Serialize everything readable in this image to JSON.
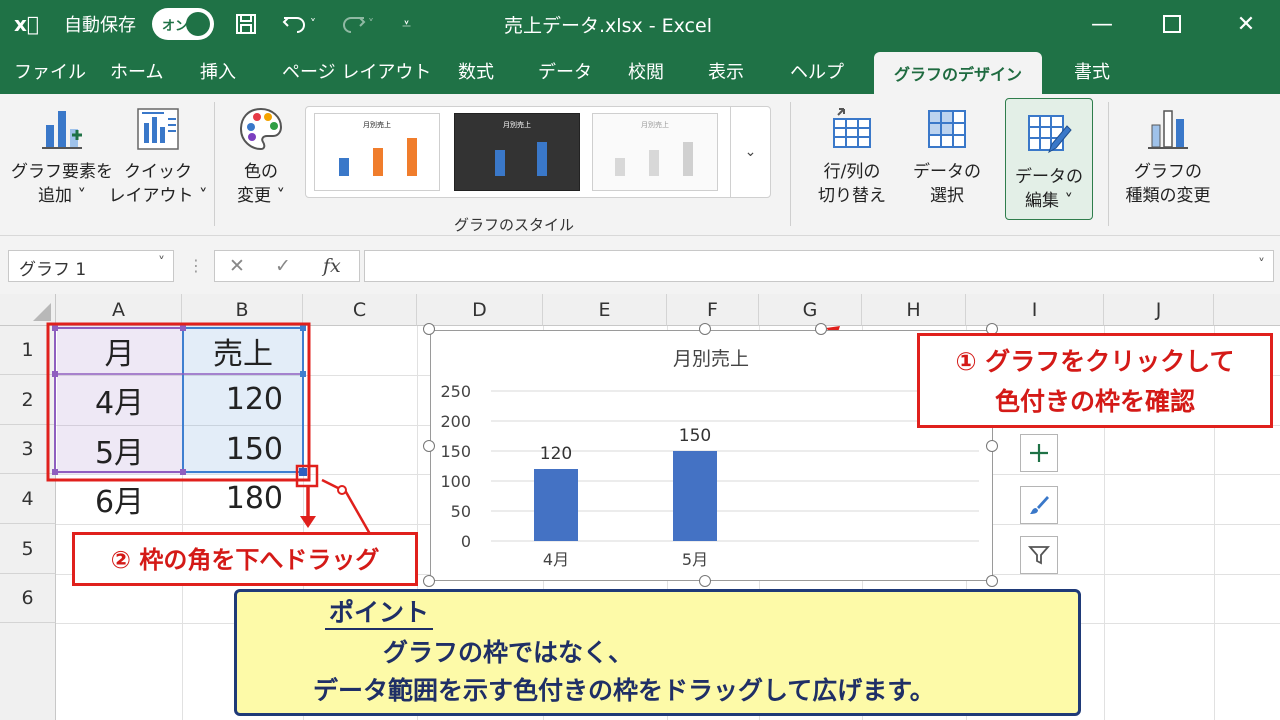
{
  "titlebar": {
    "app_icon": "excel-logo-icon",
    "autosave_label": "自動保存",
    "autosave_state": "オン",
    "document_title": "売上データ.xlsx  -  Excel"
  },
  "tabs": [
    "ファイル",
    "ホーム",
    "挿入",
    "ページ レイアウト",
    "数式",
    "データ",
    "校閲",
    "表示",
    "ヘルプ",
    "グラフのデザイン",
    "書式"
  ],
  "active_tab": "グラフのデザイン",
  "ribbon": {
    "add_element": "グラフ要素を",
    "add_element2": "追加 ˅",
    "quick_layout": "クイック",
    "quick_layout2": "レイアウト ˅",
    "change_color": "色の",
    "change_color2": "変更 ˅",
    "chart_styles_label": "グラフのスタイル",
    "style_thumb_title": "月別売上",
    "switch_row_col": "行/列の",
    "switch_row_col2": "切り替え",
    "select_data": "データの",
    "select_data2": "選択",
    "edit_data": "データの",
    "edit_data2": "編集 ˅",
    "change_type": "グラフの",
    "change_type2": "種類の変更"
  },
  "formula_bar": {
    "name_box": "グラフ 1",
    "cancel": "✕",
    "enter": "✓",
    "fx": "fx",
    "content": ""
  },
  "sheet": {
    "columns": [
      "A",
      "B",
      "C",
      "D",
      "E",
      "F",
      "G",
      "H",
      "I",
      "J"
    ],
    "rows": [
      "1",
      "2",
      "3",
      "4",
      "5",
      "6"
    ],
    "cells": {
      "A1": "月",
      "B1": "売上",
      "A2": "4月",
      "B2": "120",
      "A3": "5月",
      "B3": "150",
      "A4": "6月",
      "B4": "180"
    }
  },
  "chart_data": {
    "type": "bar",
    "title": "月別売上",
    "categories": [
      "4月",
      "5月"
    ],
    "values": [
      120,
      150
    ],
    "ylim": [
      0,
      250
    ],
    "yticks": [
      "0",
      "50",
      "100",
      "150",
      "200",
      "250"
    ],
    "data_labels": [
      "120",
      "150"
    ],
    "bar_color": "#4472c4",
    "grid": true
  },
  "chart_buttons": {
    "elements": "plus-icon",
    "styles": "brush-icon",
    "filters": "funnel-icon"
  },
  "callouts": {
    "step1_line1": "① グラフをクリックして",
    "step1_line2": "色付きの枠を確認",
    "step2": "② 枠の角を下へドラッグ"
  },
  "point": {
    "heading": "ポイント",
    "line1": "グラフの枠ではなく、",
    "line2": "データ範囲を示す色付きの枠をドラッグして広げます。"
  },
  "colors": {
    "excel_green": "#1f7246",
    "callout_red": "#e0201c",
    "range_purple": "#8f5fbf",
    "range_blue": "#3f7fd0",
    "point_bg": "#fdfaa8",
    "point_border": "#1f3a78"
  }
}
